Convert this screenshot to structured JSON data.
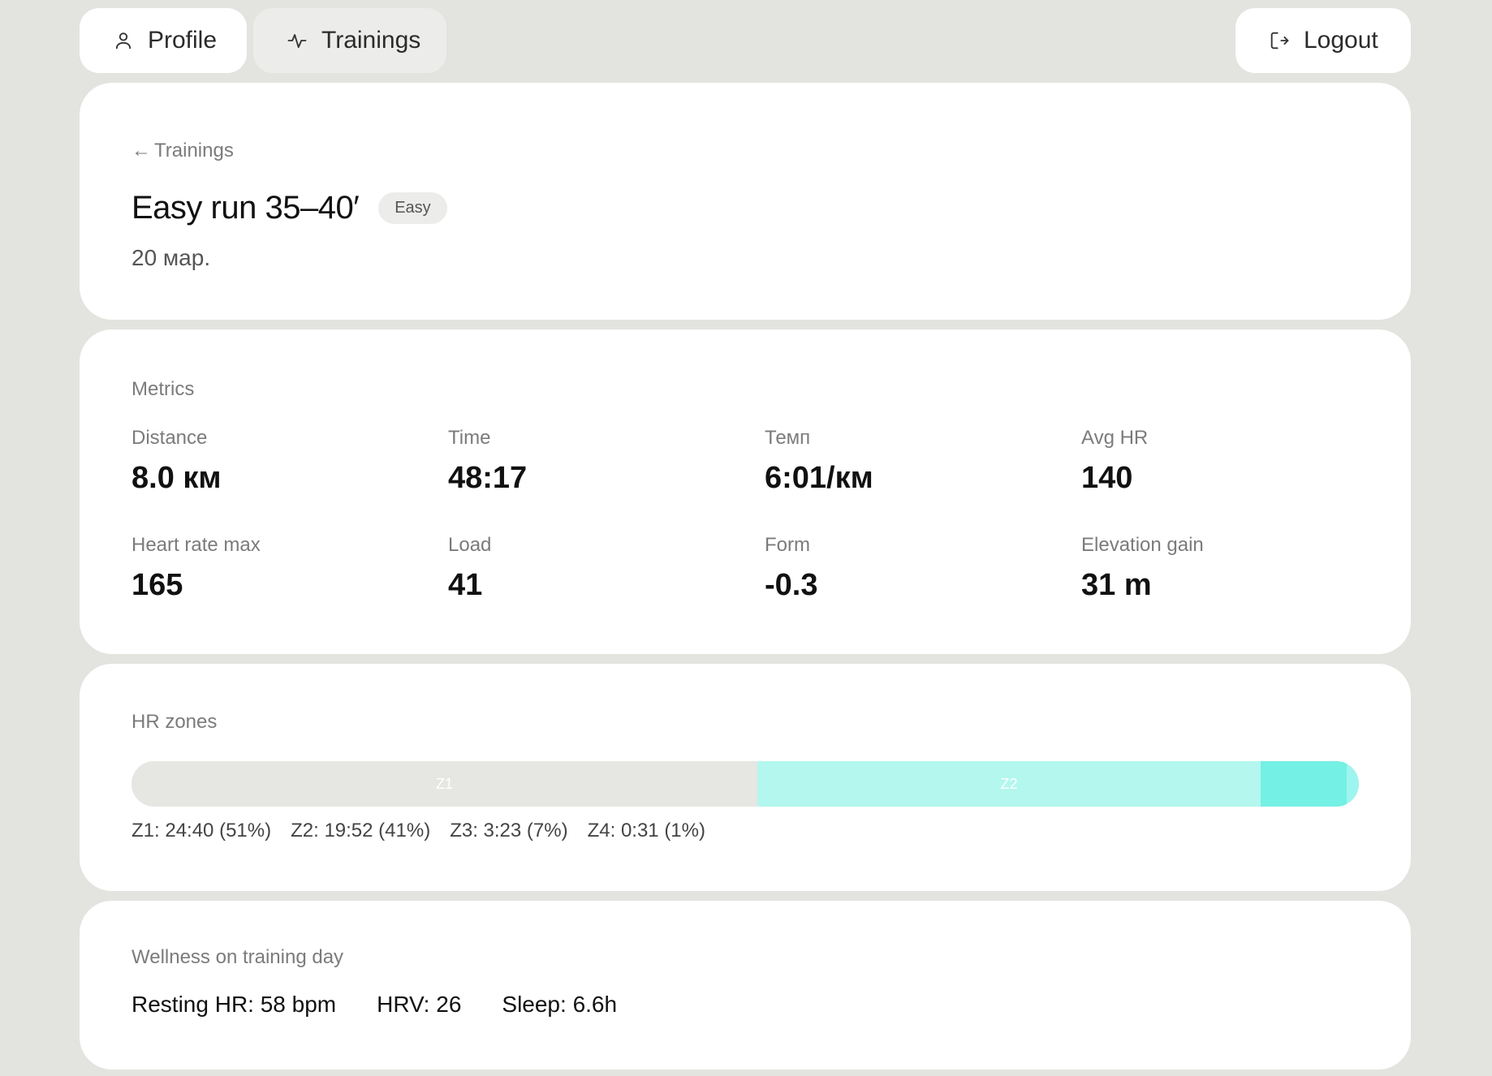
{
  "nav": {
    "profile_label": "Profile",
    "trainings_label": "Trainings",
    "logout_label": "Logout"
  },
  "header": {
    "back_label": "Trainings",
    "title": "Easy run 35–40′",
    "badge": "Easy",
    "date": "20 мар."
  },
  "metrics": {
    "section_label": "Metrics",
    "items": [
      {
        "label": "Distance",
        "value": "8.0 км"
      },
      {
        "label": "Time",
        "value": "48:17"
      },
      {
        "label": "Темп",
        "value": "6:01/км"
      },
      {
        "label": "Avg HR",
        "value": "140"
      },
      {
        "label": "Heart rate max",
        "value": "165"
      },
      {
        "label": "Load",
        "value": "41"
      },
      {
        "label": "Form",
        "value": "-0.3"
      },
      {
        "label": "Elevation gain",
        "value": "31 m"
      }
    ]
  },
  "hr_zones": {
    "section_label": "HR zones",
    "zones": [
      {
        "label": "Z1",
        "percent": 51,
        "color": "#e6e6e2",
        "legend": "Z1: 24:40 (51%)"
      },
      {
        "label": "Z2",
        "percent": 41,
        "color": "#b3f7ee",
        "legend": "Z2: 19:52 (41%)"
      },
      {
        "label": "",
        "percent": 7,
        "color": "#74f0e4",
        "legend": "Z3: 3:23 (7%)"
      },
      {
        "label": "",
        "percent": 1,
        "color": "#9ef5ef",
        "legend": "Z4: 0:31 (1%)"
      }
    ]
  },
  "wellness": {
    "section_label": "Wellness on training day",
    "resting_hr": "Resting HR: 58 bpm",
    "hrv": "HRV: 26",
    "sleep": "Sleep: 6.6h"
  },
  "colors": {
    "background": "#e3e3df",
    "card": "#ffffff",
    "muted_text": "#7b7b7b"
  }
}
